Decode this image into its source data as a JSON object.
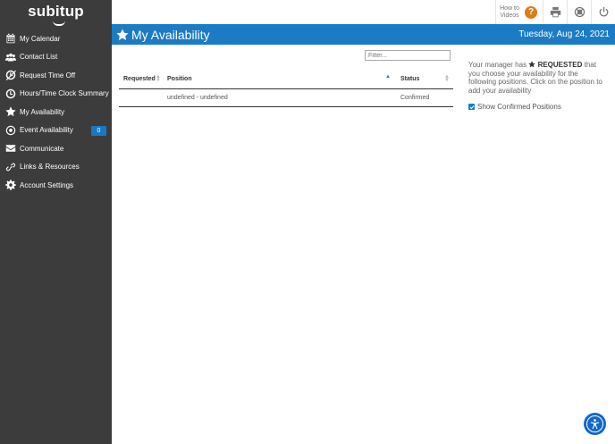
{
  "brand": {
    "logo_text": "subitup"
  },
  "sidebar": {
    "items": [
      {
        "label": "My Calendar",
        "icon": "calendar-icon"
      },
      {
        "label": "Contact List",
        "icon": "users-icon"
      },
      {
        "label": "Request Time Off",
        "icon": "time-off-icon"
      },
      {
        "label": "Hours/Time Clock Summary",
        "icon": "clock-icon"
      },
      {
        "label": "My Availability",
        "icon": "star-icon"
      },
      {
        "label": "Event Availability",
        "icon": "soccer-ball-icon",
        "badge": "0"
      },
      {
        "label": "Communicate",
        "icon": "envelope-icon"
      },
      {
        "label": "Links & Resources",
        "icon": "link-icon"
      },
      {
        "label": "Account Settings",
        "icon": "gear-icon"
      }
    ]
  },
  "toolbar": {
    "how_to_videos_label": "How to Videos",
    "help_icon_text": "?",
    "icons": [
      "print-icon",
      "support-icon",
      "power-icon"
    ]
  },
  "header": {
    "title": "My Availability",
    "date": "Tuesday, Aug 24, 2021"
  },
  "filter": {
    "placeholder": "Filter..."
  },
  "table": {
    "columns": [
      "Requested",
      "Position",
      "Status"
    ],
    "rows": [
      {
        "requested": "",
        "position": "undefined - undefined",
        "status": "Confirmed"
      }
    ]
  },
  "info": {
    "text_before": "Your manager has",
    "highlight": "REQUESTED",
    "text_after": "that you choose your availability for the following positions. Click on the position to add your availability"
  },
  "show_confirmed": {
    "label": "Show Confirmed Positions",
    "checked": true
  },
  "colors": {
    "primary": "#1b7bc5",
    "sidebar": "#3c3c3c",
    "help": "#e07b16"
  }
}
